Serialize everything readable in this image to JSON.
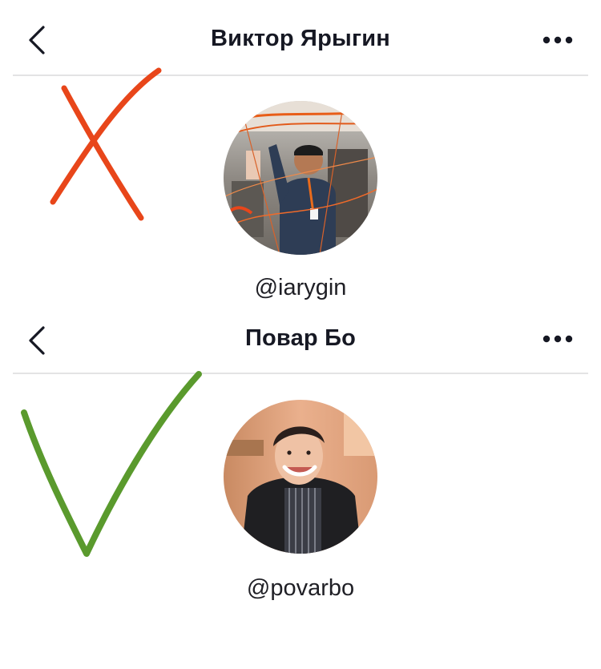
{
  "profile_1": {
    "title": "Виктор Ярыгин",
    "username": "@iarygin",
    "verdict_icon": "cross-mark-icon",
    "verdict_color": "#e8461a"
  },
  "profile_2": {
    "title": "Повар Бо",
    "username": "@povarbo",
    "verdict_icon": "check-mark-icon",
    "verdict_color": "#5a9a2d"
  },
  "icons": {
    "back": "chevron-left-icon",
    "more": "more-horizontal-icon"
  }
}
